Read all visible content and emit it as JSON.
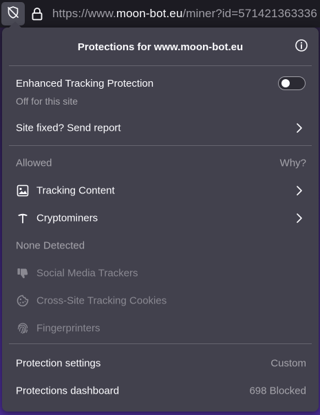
{
  "urlbar": {
    "url_prefix": "https://www.",
    "url_host": "moon-bot.eu",
    "url_suffix": "/miner?id=571421363336"
  },
  "panel": {
    "title": "Protections for www.moon-bot.eu",
    "etp": {
      "label": "Enhanced Tracking Protection",
      "status": "Off for this site",
      "enabled": false
    },
    "report": {
      "label": "Site fixed? Send report"
    },
    "allowed": {
      "heading": "Allowed",
      "why_link": "Why?",
      "items": [
        {
          "label": "Tracking Content",
          "icon": "image-icon"
        },
        {
          "label": "Cryptominers",
          "icon": "pickaxe-icon"
        }
      ]
    },
    "none_detected": {
      "heading": "None Detected",
      "items": [
        {
          "label": "Social Media Trackers",
          "icon": "thumbs-down-icon"
        },
        {
          "label": "Cross-Site Tracking Cookies",
          "icon": "cookie-icon"
        },
        {
          "label": "Fingerprinters",
          "icon": "fingerprint-icon"
        }
      ]
    },
    "footer": {
      "settings_label": "Protection settings",
      "settings_value": "Custom",
      "dashboard_label": "Protections dashboard",
      "dashboard_value": "698 Blocked"
    }
  },
  "colors": {
    "panel_bg": "#42414d",
    "text": "#fbfbfe",
    "text_dim": "#a5a4ab",
    "backdrop_accent": "#4a2d92"
  }
}
